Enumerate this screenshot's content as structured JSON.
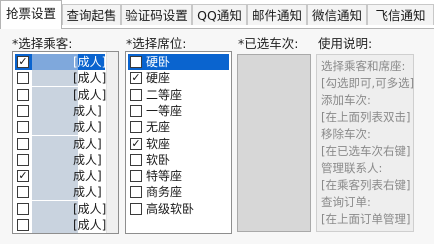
{
  "tabs": [
    "抢票设置",
    "查询起售",
    "验证码设置",
    "QQ通知",
    "邮件通知",
    "微信通知",
    "飞信通知"
  ],
  "passengers": {
    "label": "*选择乘客:",
    "items": [
      {
        "checked": true,
        "text": "[成人]",
        "selected": true
      },
      {
        "checked": false,
        "text": "[成人]",
        "selected": false
      },
      {
        "checked": false,
        "text": "[成人]",
        "selected": false
      },
      {
        "checked": false,
        "text": "成人]",
        "selected": false
      },
      {
        "checked": false,
        "text": "成人]",
        "selected": false
      },
      {
        "checked": false,
        "text": "成人]",
        "selected": false
      },
      {
        "checked": false,
        "text": "成人]",
        "selected": false
      },
      {
        "checked": true,
        "text": "成人]",
        "selected": false
      },
      {
        "checked": false,
        "text": "成人]",
        "selected": false
      },
      {
        "checked": false,
        "text": "[成人]",
        "selected": false
      },
      {
        "checked": false,
        "text": "[成人]",
        "selected": false
      }
    ]
  },
  "seats": {
    "label": "*选择席位:",
    "items": [
      {
        "checked": false,
        "text": "硬卧",
        "selected": true
      },
      {
        "checked": true,
        "text": "硬座",
        "selected": false
      },
      {
        "checked": false,
        "text": "二等座",
        "selected": false
      },
      {
        "checked": false,
        "text": "一等座",
        "selected": false
      },
      {
        "checked": false,
        "text": "无座",
        "selected": false
      },
      {
        "checked": true,
        "text": "软座",
        "selected": false
      },
      {
        "checked": false,
        "text": "软卧",
        "selected": false
      },
      {
        "checked": false,
        "text": "特等座",
        "selected": false
      },
      {
        "checked": false,
        "text": "商务座",
        "selected": false
      },
      {
        "checked": false,
        "text": "高级软卧",
        "selected": false
      }
    ]
  },
  "trains": {
    "label": "*已选车次:"
  },
  "help": {
    "label": "使用说明:",
    "lines": [
      "选择乘客和席座:",
      "[勾选即可,可多选]",
      "添加车次:",
      "[在上面列表双击]",
      "移除车次:",
      "[在已选车次右键]",
      "管理联系人:",
      "[在乘客列表右键]",
      "查询订单:",
      "[在上面订单管理]"
    ]
  }
}
